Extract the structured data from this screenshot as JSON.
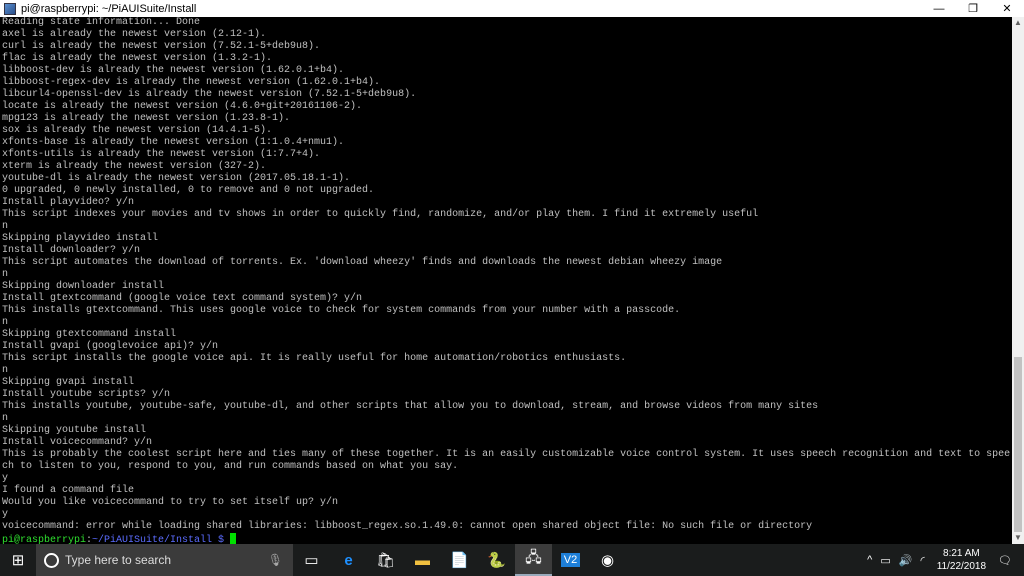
{
  "window": {
    "title": "pi@raspberrypi: ~/PiAUISuite/Install",
    "minimize": "—",
    "restore": "❐",
    "close": "✕"
  },
  "terminal": {
    "lines": [
      "Reading state information... Done",
      "axel is already the newest version (2.12-1).",
      "curl is already the newest version (7.52.1-5+deb9u8).",
      "flac is already the newest version (1.3.2-1).",
      "libboost-dev is already the newest version (1.62.0.1+b4).",
      "libboost-regex-dev is already the newest version (1.62.0.1+b4).",
      "libcurl4-openssl-dev is already the newest version (7.52.1-5+deb9u8).",
      "locate is already the newest version (4.6.0+git+20161106-2).",
      "mpg123 is already the newest version (1.23.8-1).",
      "sox is already the newest version (14.4.1-5).",
      "xfonts-base is already the newest version (1:1.0.4+nmu1).",
      "xfonts-utils is already the newest version (1:7.7+4).",
      "xterm is already the newest version (327-2).",
      "youtube-dl is already the newest version (2017.05.18.1-1).",
      "0 upgraded, 0 newly installed, 0 to remove and 0 not upgraded.",
      "Install playvideo? y/n",
      "This script indexes your movies and tv shows in order to quickly find, randomize, and/or play them. I find it extremely useful",
      "n",
      "Skipping playvideo install",
      "Install downloader? y/n",
      "This script automates the download of torrents. Ex. 'download wheezy' finds and downloads the newest debian wheezy image",
      "n",
      "Skipping downloader install",
      "Install gtextcommand (google voice text command system)? y/n",
      "This installs gtextcommand. This uses google voice to check for system commands from your number with a passcode.",
      "n",
      "Skipping gtextcommand install",
      "Install gvapi (googlevoice api)? y/n",
      "This script installs the google voice api. It is really useful for home automation/robotics enthusiasts.",
      "n",
      "Skipping gvapi install",
      "Install youtube scripts? y/n",
      "This installs youtube, youtube-safe, youtube-dl, and other scripts that allow you to download, stream, and browse videos from many sites",
      "n",
      "Skipping youtube install",
      "Install voicecommand? y/n",
      "This is probably the coolest script here and ties many of these together. It is an easily customizable voice control system. It uses speech recognition and text to spee",
      "ch to listen to you, respond to you, and run commands based on what you say.",
      "y",
      "I found a command file",
      "Would you like voicecommand to try to set itself up? y/n",
      "y",
      "voicecommand: error while loading shared libraries: libboost_regex.so.1.49.0: cannot open shared object file: No such file or directory"
    ],
    "prompt": {
      "user": "pi@raspberrypi",
      "sep": ":",
      "path": "~/PiAUISuite/Install $ "
    }
  },
  "taskbar": {
    "search_placeholder": "Type here to search",
    "time": "8:21 AM",
    "date": "11/22/2018"
  }
}
